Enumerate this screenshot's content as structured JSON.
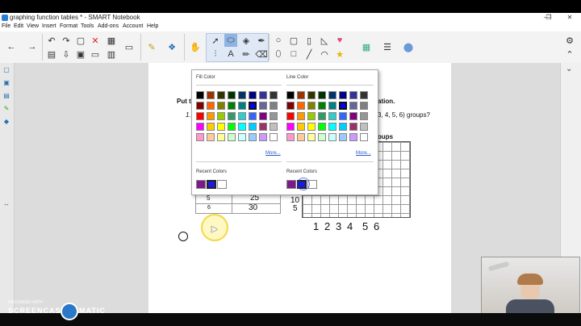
{
  "window": {
    "title": "graphing function tables * - SMART Notebook",
    "minimize": "—",
    "maximize": "❐",
    "close": "✕"
  },
  "menu": [
    "File",
    "Edit",
    "View",
    "Insert",
    "Format",
    "Tools",
    "Add-ons",
    "Account",
    "Help"
  ],
  "page": {
    "instruction_prefix": "Put t",
    "instruction_suffix": "ation.",
    "question_prefix": "1.",
    "question_suffix": "3, 4, 5, 6) groups?",
    "graph_title_suffix": "oups",
    "table_rows": [
      {
        "x": "5",
        "y": "25"
      },
      {
        "x": "6",
        "y": "30"
      }
    ],
    "y_axis_labels": [
      "15",
      "10",
      "5"
    ],
    "x_axis_labels": [
      "1",
      "2",
      "3",
      "4",
      "5",
      "6"
    ]
  },
  "color_popup": {
    "fill_title": "Fill Color",
    "line_title": "Line Color",
    "more_label": "More...",
    "recent_title": "Recent Colors",
    "palette": [
      [
        "#000000",
        "#993300",
        "#333300",
        "#003300",
        "#003366",
        "#000080",
        "#333399",
        "#333333"
      ],
      [
        "#800000",
        "#ff6600",
        "#808000",
        "#008000",
        "#008080",
        "#0000ff",
        "#666699",
        "#808080"
      ],
      [
        "#ff0000",
        "#ff9900",
        "#99cc00",
        "#339966",
        "#33cccc",
        "#3366ff",
        "#800080",
        "#969696"
      ],
      [
        "#ff00ff",
        "#ffcc00",
        "#ffff00",
        "#00ff00",
        "#00ffff",
        "#00ccff",
        "#993366",
        "#c0c0c0"
      ],
      [
        "#ff99cc",
        "#ffcc99",
        "#ffff99",
        "#ccffcc",
        "#ccffff",
        "#99ccff",
        "#cc99ff",
        "#ffffff"
      ]
    ],
    "fill_recent": [
      "#7b1a8a",
      "#1a1ae6",
      "#ffffff"
    ],
    "line_recent": [
      "#7b1a8a",
      "#1a1ae6",
      "#ffffff"
    ]
  },
  "watermark": {
    "line1": "RECORDED WITH",
    "line2": "SCREENCAST",
    "line3": "MATIC"
  }
}
